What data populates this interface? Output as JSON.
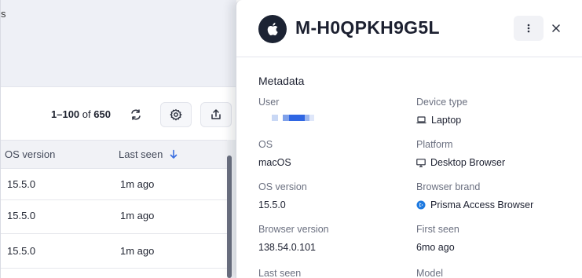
{
  "background_panel": {
    "top_glyph": "s",
    "pager": {
      "range": "1–100",
      "of": "of",
      "total": "650"
    },
    "columns": {
      "os_version": "OS version",
      "last_seen": "Last seen"
    },
    "rows": [
      {
        "os_version": "15.5.0",
        "last_seen": "1m ago"
      },
      {
        "os_version": "15.5.0",
        "last_seen": "1m ago"
      },
      {
        "os_version": "15.5.0",
        "last_seen": "1m ago"
      }
    ]
  },
  "drawer": {
    "title": "M-H0QPKH9G5L",
    "section_title": "Metadata",
    "fields": {
      "user": {
        "label": "User",
        "value": ""
      },
      "device_type": {
        "label": "Device type",
        "value": "Laptop",
        "icon": "laptop-icon"
      },
      "os": {
        "label": "OS",
        "value": "macOS"
      },
      "platform": {
        "label": "Platform",
        "value": "Desktop Browser",
        "icon": "monitor-icon"
      },
      "os_version": {
        "label": "OS version",
        "value": "15.5.0"
      },
      "browser_brand": {
        "label": "Browser brand",
        "value": "Prisma Access Browser",
        "icon": "prisma-browser-icon"
      },
      "browser_version": {
        "label": "Browser version",
        "value": "138.54.0.101"
      },
      "first_seen": {
        "label": "First seen",
        "value": "6mo ago"
      },
      "last_seen": {
        "label": "Last seen"
      },
      "model": {
        "label": "Model"
      }
    }
  },
  "colors": {
    "accent": "#3b6fe0",
    "avatar_bg": "#1c2333",
    "header_bg": "#eef0f6"
  }
}
